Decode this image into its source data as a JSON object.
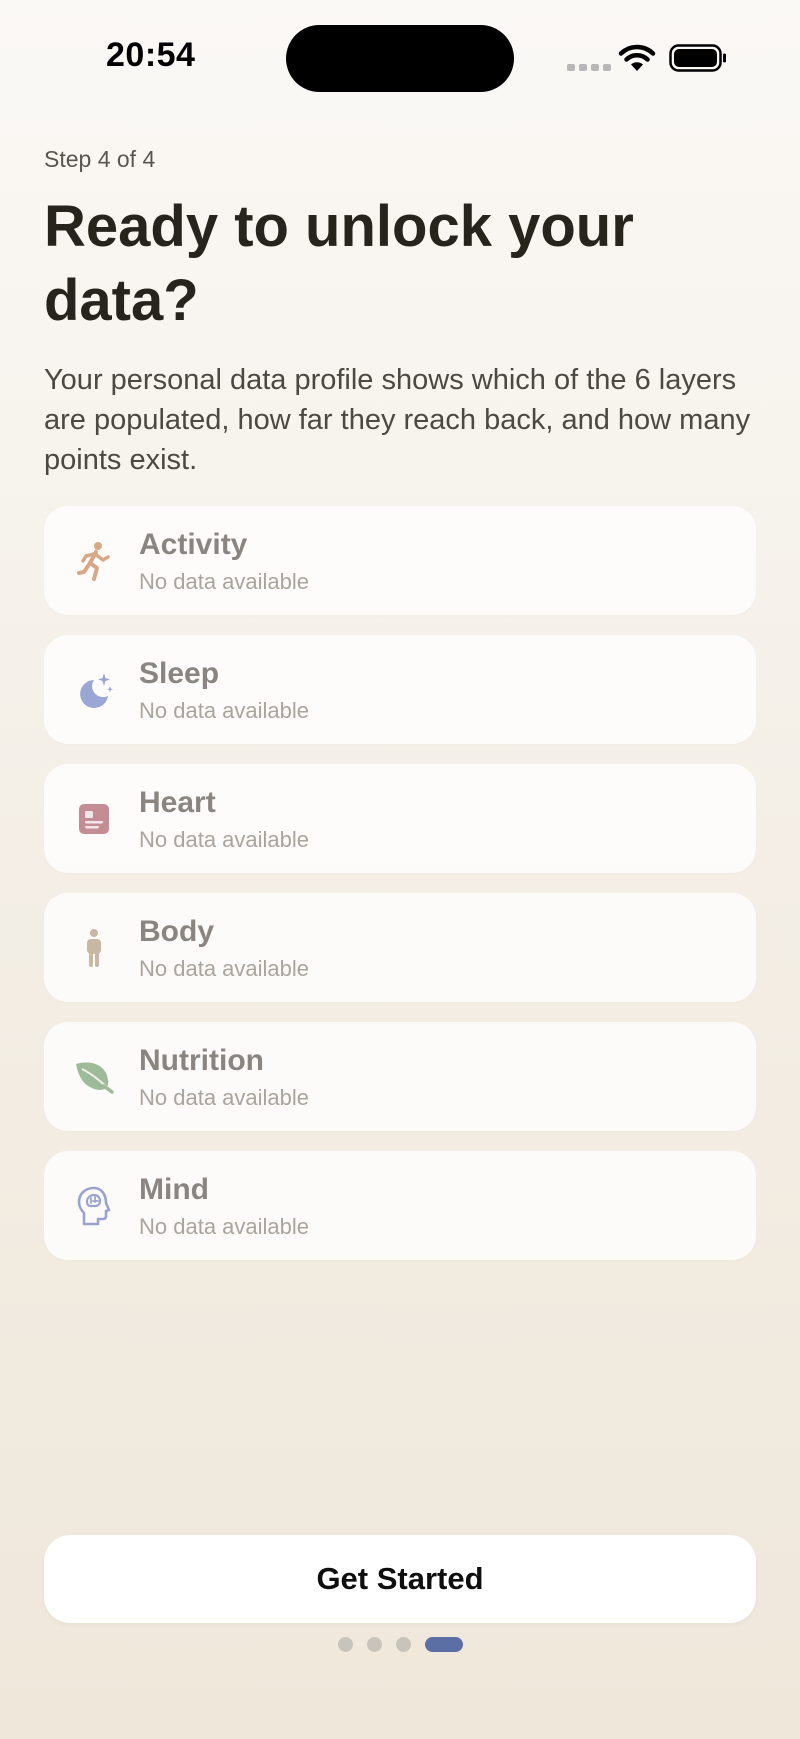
{
  "status_bar": {
    "time": "20:54"
  },
  "onboarding": {
    "step_label": "Step 4 of 4",
    "title": "Ready to unlock your data?",
    "description": "Your personal data profile shows which of the 6 layers are populated, how far they reach back, and how many points exist."
  },
  "layers": [
    {
      "name": "Activity",
      "status": "No data available",
      "icon": "running-figure-icon",
      "color": "#d8a886"
    },
    {
      "name": "Sleep",
      "status": "No data available",
      "icon": "moon-stars-icon",
      "color": "#9aa6d4"
    },
    {
      "name": "Heart",
      "status": "No data available",
      "icon": "heart-record-icon",
      "color": "#c48d93"
    },
    {
      "name": "Body",
      "status": "No data available",
      "icon": "person-figure-icon",
      "color": "#c8b8a3"
    },
    {
      "name": "Nutrition",
      "status": "No data available",
      "icon": "leaf-icon",
      "color": "#9dbb98"
    },
    {
      "name": "Mind",
      "status": "No data available",
      "icon": "brain-head-icon",
      "color": "#9aa3cf"
    }
  ],
  "cta": {
    "label": "Get Started"
  },
  "pager": {
    "total": 4,
    "current": 4,
    "active_color": "#5b6fa5"
  }
}
